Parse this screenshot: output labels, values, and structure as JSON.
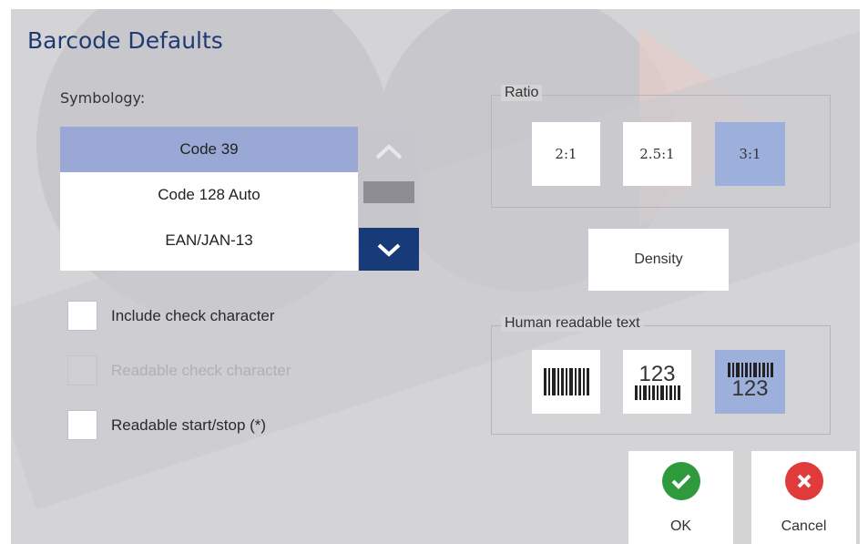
{
  "dialog": {
    "title": "Barcode Defaults"
  },
  "symbology": {
    "label": "Symbology:",
    "items": [
      "Code 39",
      "Code 128 Auto",
      "EAN/JAN-13"
    ],
    "selected": "Code 39"
  },
  "checkboxes": [
    {
      "label": "Include check character",
      "checked": false,
      "enabled": true
    },
    {
      "label": "Readable check character",
      "checked": false,
      "enabled": false
    },
    {
      "label": "Readable start/stop (*)",
      "checked": false,
      "enabled": true
    }
  ],
  "ratio": {
    "label": "Ratio",
    "options": [
      "2:1",
      "2.5:1",
      "3:1"
    ],
    "selected": "3:1"
  },
  "density": {
    "label": "Density"
  },
  "human_readable": {
    "label": "Human readable text",
    "options": [
      {
        "icon": "barcode-no-text-icon"
      },
      {
        "icon": "barcode-text-above-icon",
        "text": "123"
      },
      {
        "icon": "barcode-text-below-icon",
        "text": "123"
      }
    ],
    "selected_icon": "barcode-text-below-icon"
  },
  "buttons": {
    "ok": {
      "label": "OK",
      "icon": "check-circle-icon",
      "color": "#2e9a3c"
    },
    "cancel": {
      "label": "Cancel",
      "icon": "x-circle-icon",
      "color": "#e03a3a"
    }
  },
  "colors": {
    "title": "#1f3a73",
    "selection": "#9aa8d6",
    "scroll_down": "#173a78"
  }
}
